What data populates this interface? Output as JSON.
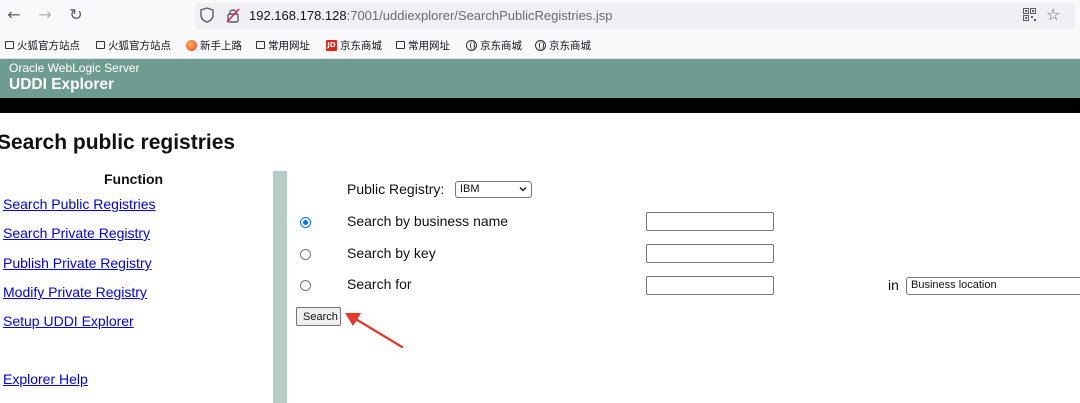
{
  "browser": {
    "url_host": "192.168.178.128",
    "url_rest": ":7001/uddiexplorer/SearchPublicRegistries.jsp",
    "bookmarks": [
      {
        "label": "火狐官方站点",
        "icon": "folder-icon"
      },
      {
        "label": "火狐官方站点",
        "icon": "folder-icon"
      },
      {
        "label": "新手上路",
        "icon": "firefox-icon"
      },
      {
        "label": "常用网址",
        "icon": "folder-icon"
      },
      {
        "label": "京东商城",
        "icon": "jd-icon"
      },
      {
        "label": "常用网址",
        "icon": "folder-icon"
      },
      {
        "label": "京东商城",
        "icon": "globe-icon"
      },
      {
        "label": "京东商城",
        "icon": "globe-icon"
      }
    ],
    "jd_badge": "JD"
  },
  "header": {
    "product": "Oracle WebLogic Server",
    "app": "UDDI Explorer"
  },
  "page": {
    "title": "Search public registries"
  },
  "sidebar": {
    "title": "Function",
    "links": [
      "Search Public Registries",
      "Search Private Registry",
      "Publish Private Registry",
      "Modify Private Registry",
      "Setup UDDI Explorer",
      "Explorer Help"
    ]
  },
  "form": {
    "registry_label": "Public Registry:",
    "registry_value": "IBM",
    "options": [
      {
        "label": "Search by business name",
        "selected": true
      },
      {
        "label": "Search by key",
        "selected": false
      },
      {
        "label": "Search for",
        "selected": false
      }
    ],
    "in_label": "in",
    "location_value": "Business location",
    "search_button": "Search"
  },
  "colors": {
    "header_bg": "#6f9c91",
    "divider": "#b8ccc7",
    "link": "#0000ee",
    "annotation_arrow": "#e8362a"
  }
}
